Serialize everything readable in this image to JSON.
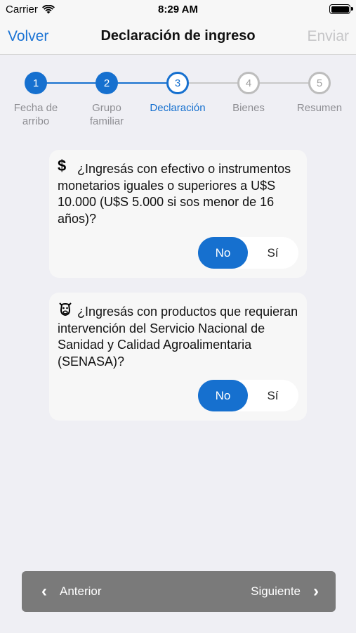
{
  "status_bar": {
    "carrier": "Carrier",
    "time": "8:29 AM"
  },
  "nav": {
    "back_label": "Volver",
    "title": "Declaración de ingreso",
    "send_label": "Enviar"
  },
  "stepper": {
    "steps": [
      {
        "number": "1",
        "label": "Fecha de arribo",
        "state": "done"
      },
      {
        "number": "2",
        "label": "Grupo familiar",
        "state": "done"
      },
      {
        "number": "3",
        "label": "Declaración",
        "state": "current"
      },
      {
        "number": "4",
        "label": "Bienes",
        "state": "pending"
      },
      {
        "number": "5",
        "label": "Resumen",
        "state": "pending"
      }
    ]
  },
  "questions": [
    {
      "icon": "dollar-icon",
      "text": "¿Ingresás con efectivo o instrumentos monetarios iguales o superiores a U$S 10.000 (U$S 5.000 si sos menor de 16 años)?",
      "options": [
        "No",
        "Sí"
      ],
      "selected": "No"
    },
    {
      "icon": "cow-icon",
      "text": "¿Ingresás con productos que requieran intervención del Servicio Nacional de Sanidad y Calidad Agroalimentaria (SENASA)?",
      "options": [
        "No",
        "Sí"
      ],
      "selected": "No"
    }
  ],
  "bottom_nav": {
    "prev_label": "Anterior",
    "next_label": "Siguiente"
  },
  "colors": {
    "accent": "#1670cf",
    "disabled": "#c6c6c8",
    "bottom_bar": "#7a7a7a"
  }
}
